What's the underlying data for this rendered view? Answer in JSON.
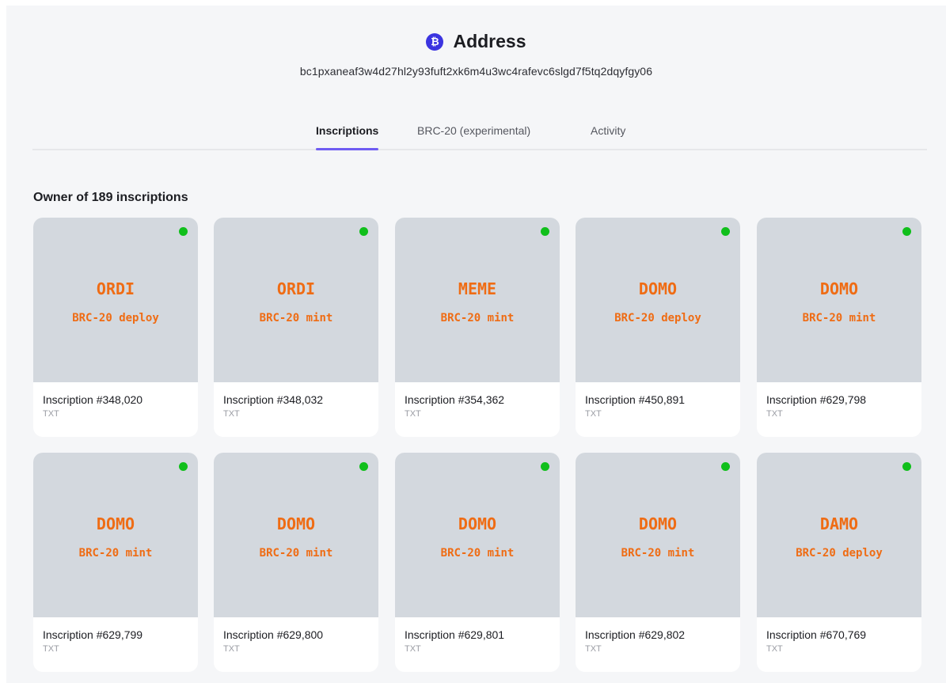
{
  "header": {
    "icon": "bitcoin-icon",
    "title": "Address",
    "address": "bc1pxaneaf3w4d27hl2y93fuft2xk6m4u3wc4rafevc6slgd7f5tq2dqyfgy06"
  },
  "tabs": [
    {
      "label": "Inscriptions",
      "active": true
    },
    {
      "label": "BRC-20 (experimental)",
      "active": false
    },
    {
      "label": "Activity",
      "active": false
    }
  ],
  "owner_text": "Owner of 189 inscriptions",
  "colors": {
    "accent": "#6f5cf2",
    "ticker": "#ef6c14",
    "status_dot": "#10bf1b",
    "btc_icon": "#3b34e0"
  },
  "cards": [
    {
      "ticker": "ORDI",
      "op": "BRC-20 deploy",
      "inscription": "Inscription #348,020",
      "type": "TXT"
    },
    {
      "ticker": "ORDI",
      "op": "BRC-20 mint",
      "inscription": "Inscription #348,032",
      "type": "TXT"
    },
    {
      "ticker": "MEME",
      "op": "BRC-20 mint",
      "inscription": "Inscription #354,362",
      "type": "TXT"
    },
    {
      "ticker": "DOMO",
      "op": "BRC-20 deploy",
      "inscription": "Inscription #450,891",
      "type": "TXT"
    },
    {
      "ticker": "DOMO",
      "op": "BRC-20 mint",
      "inscription": "Inscription #629,798",
      "type": "TXT"
    },
    {
      "ticker": "DOMO",
      "op": "BRC-20 mint",
      "inscription": "Inscription #629,799",
      "type": "TXT"
    },
    {
      "ticker": "DOMO",
      "op": "BRC-20 mint",
      "inscription": "Inscription #629,800",
      "type": "TXT"
    },
    {
      "ticker": "DOMO",
      "op": "BRC-20 mint",
      "inscription": "Inscription #629,801",
      "type": "TXT"
    },
    {
      "ticker": "DOMO",
      "op": "BRC-20 mint",
      "inscription": "Inscription #629,802",
      "type": "TXT"
    },
    {
      "ticker": "DAMO",
      "op": "BRC-20 deploy",
      "inscription": "Inscription #670,769",
      "type": "TXT"
    }
  ]
}
